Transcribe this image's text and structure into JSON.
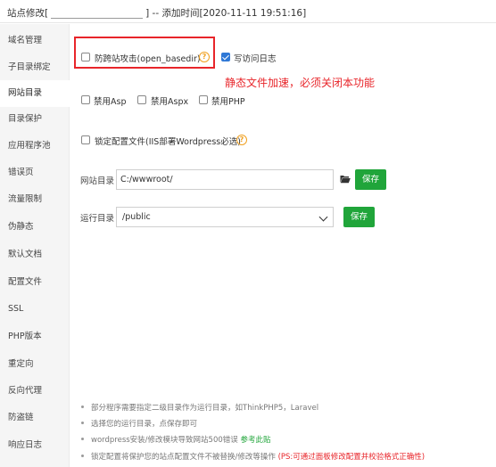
{
  "titlebar": {
    "prefix": "站点修改[",
    "suffix": "] -- 添加时间[2020-11-11 19:51:16]"
  },
  "sidebar": {
    "items": [
      {
        "label": "域名管理"
      },
      {
        "label": "子目录绑定"
      },
      {
        "label": "网站目录",
        "active": true
      },
      {
        "label": "目录保护"
      },
      {
        "label": "应用程序池"
      },
      {
        "label": "错误页"
      },
      {
        "label": "流量限制"
      },
      {
        "label": "伪静态"
      },
      {
        "label": "默认文档"
      },
      {
        "label": "配置文件"
      },
      {
        "label": "SSL"
      },
      {
        "label": "PHP版本"
      },
      {
        "label": "重定向"
      },
      {
        "label": "反向代理"
      },
      {
        "label": "防盗链"
      },
      {
        "label": "响应日志"
      }
    ]
  },
  "options": {
    "open_basedir": {
      "label": "防跨站攻击(open_basedir)",
      "checked": false
    },
    "write_log": {
      "label": "写访问日志",
      "checked": true
    },
    "disable_asp": {
      "label": "禁用Asp",
      "checked": false
    },
    "disable_aspx": {
      "label": "禁用Aspx",
      "checked": false
    },
    "disable_php": {
      "label": "禁用PHP",
      "checked": false
    },
    "lock_config": {
      "label": "锁定配置文件(IIS部署Wordpress必选)",
      "checked": false
    }
  },
  "help_icon": {
    "glyph": "?",
    "icon": "question-circle-icon",
    "color": "#f0a020"
  },
  "annotation": "静态文件加速，必须关闭本功能",
  "site_dir": {
    "label": "网站目录",
    "value": "C:/wwwroot/",
    "save_label": "保存"
  },
  "run_dir": {
    "label": "运行目录",
    "value": "/public",
    "save_label": "保存"
  },
  "notes": [
    {
      "text": "部分程序需要指定二级目录作为运行目录，如ThinkPHP5，Laravel"
    },
    {
      "text": "选择您的运行目录，点保存即可"
    },
    {
      "text": "wordpress安装/修改模块导致网站500错误 ",
      "link": "参考此贴"
    },
    {
      "text": "锁定配置将保护您的站点配置文件不被替换/修改等操作 ",
      "red": "(PS:可通过面板修改配置并校验格式正确性)"
    }
  ],
  "colors": {
    "accent_green": "#20a53a",
    "annotation_red": "#e8252a",
    "checkbox_blue": "#2f78d6"
  }
}
